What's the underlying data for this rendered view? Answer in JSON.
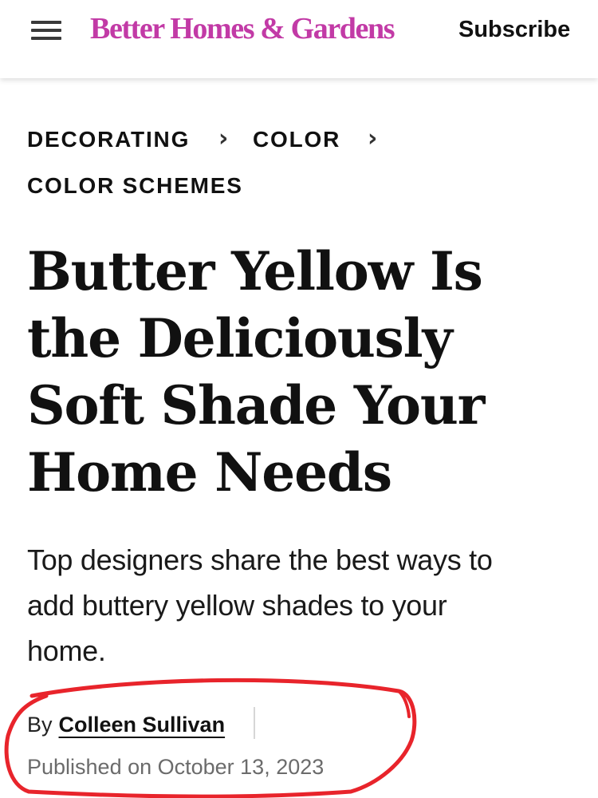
{
  "header": {
    "logo": "Better Homes & Gardens",
    "subscribe_label": "Subscribe",
    "menu_icon": "hamburger-menu-icon",
    "logo_color": "#c23aa6"
  },
  "breadcrumb": {
    "items": [
      "DECORATING",
      "COLOR",
      "COLOR SCHEMES"
    ],
    "separator_icon": "chevron-right-icon"
  },
  "article": {
    "title_lines": [
      "Butter Yellow Is",
      "the Deliciously",
      "Soft Shade Your",
      "Home Needs"
    ],
    "dek_lines": [
      "Top designers share the best ways to",
      "add buttery yellow shades to your",
      "home."
    ],
    "byline": {
      "by_label": "By",
      "author": "Colleen Sullivan",
      "published": "Published on October 13, 2023"
    }
  },
  "annotation": {
    "shape": "hand-drawn-circle",
    "color": "#e8242b"
  }
}
